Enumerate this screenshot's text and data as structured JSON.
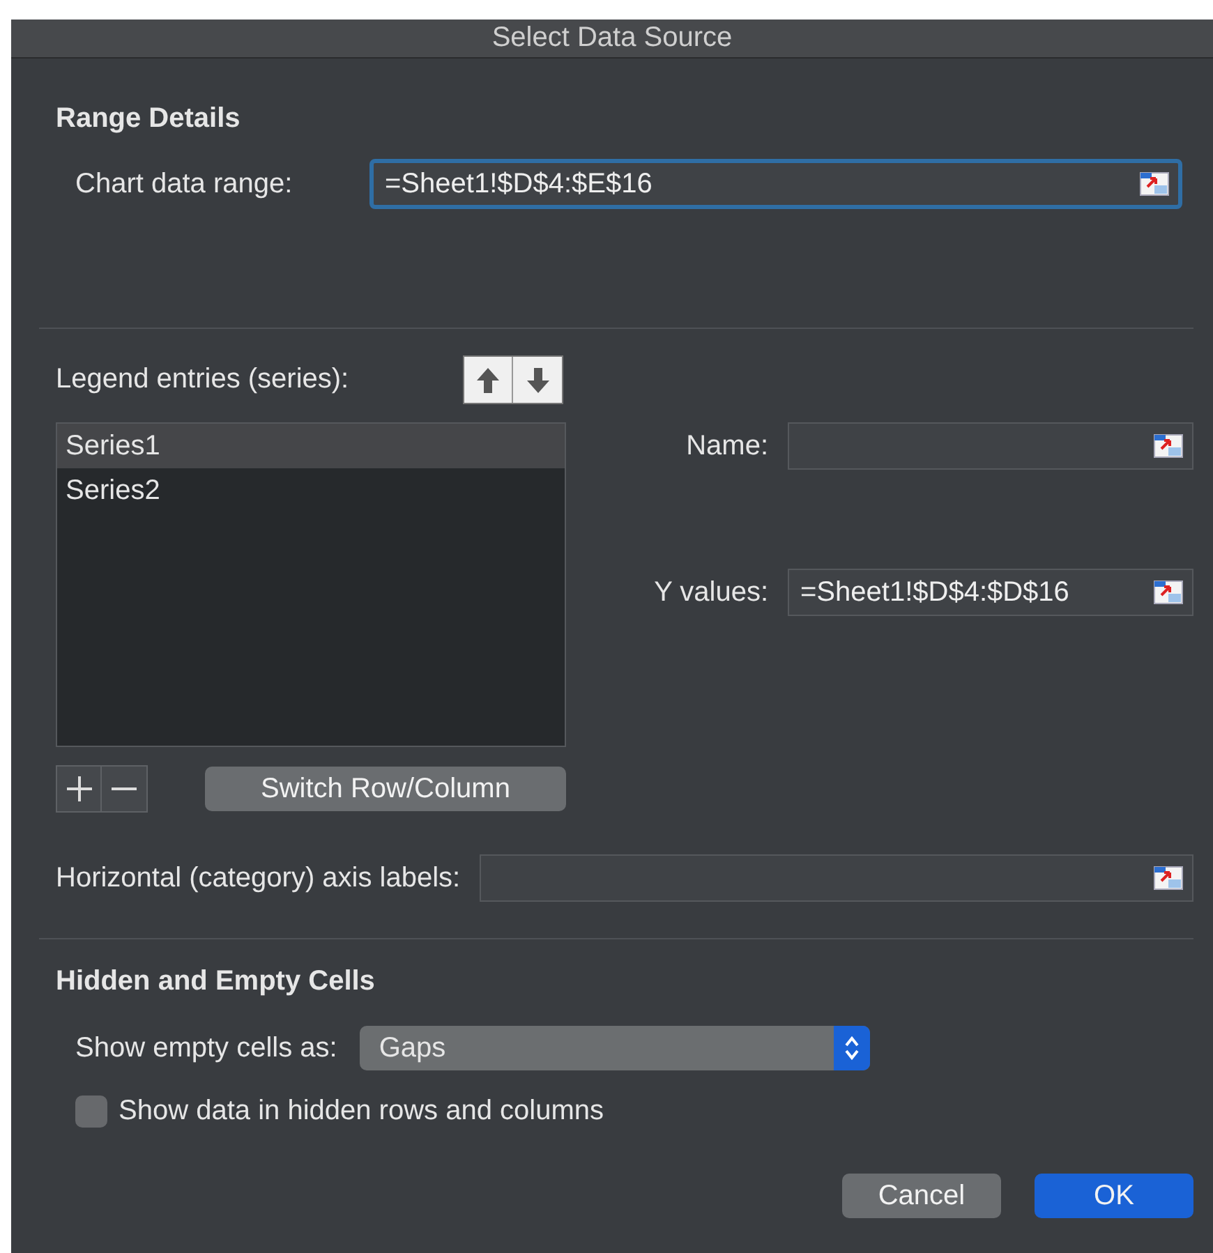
{
  "window": {
    "title": "Select Data Source"
  },
  "range_details": {
    "heading": "Range Details",
    "chart_data_range": {
      "label": "Chart data range:",
      "value": "=Sheet1!$D$4:$E$16",
      "focused": true
    }
  },
  "legend": {
    "label": "Legend entries (series):",
    "series": [
      {
        "name": "Series1",
        "selected": true
      },
      {
        "name": "Series2",
        "selected": false
      }
    ],
    "switch_button": "Switch Row/Column"
  },
  "series_fields": [
    {
      "label": "Name:"
    },
    {
      "label": "Y values:",
      "value": "=Sheet1!$D$4:$D$16"
    }
  ],
  "axis_labels": {
    "label": "Horizontal (category) axis labels:"
  },
  "hidden_empty": {
    "heading": "Hidden and Empty Cells",
    "show_empty": {
      "label": "Show empty cells as:",
      "value": "Gaps"
    },
    "show_hidden": {
      "label": "Show data in hidden rows and columns",
      "checked": false
    }
  },
  "buttons": [
    {
      "label": "Cancel",
      "default": false
    },
    {
      "label": "OK",
      "default": true
    }
  ]
}
